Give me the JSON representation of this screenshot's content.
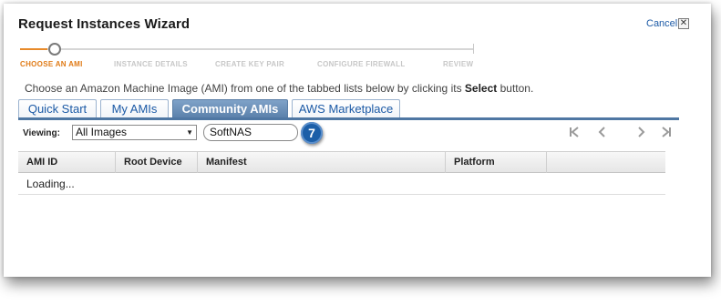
{
  "window": {
    "title": "Request Instances Wizard",
    "cancel_label": "Cancel",
    "close_glyph": "✕"
  },
  "steps": [
    {
      "label": "CHOOSE AN AMI",
      "active": true
    },
    {
      "label": "INSTANCE DETAILS",
      "active": false
    },
    {
      "label": "CREATE KEY PAIR",
      "active": false
    },
    {
      "label": "CONFIGURE FIREWALL",
      "active": false
    },
    {
      "label": "REVIEW",
      "active": false
    }
  ],
  "instructions": {
    "before": "Choose an Amazon Machine Image (AMI) from one of the tabbed lists below by clicking its ",
    "bold": "Select",
    "after": " button."
  },
  "tabs": [
    {
      "label": "Quick Start",
      "selected": false
    },
    {
      "label": "My AMIs",
      "selected": false
    },
    {
      "label": "Community AMIs",
      "selected": true
    },
    {
      "label": "AWS Marketplace",
      "selected": false
    }
  ],
  "filter": {
    "viewing_label": "Viewing:",
    "selected_option": "All Images",
    "search_value": "SoftNAS",
    "callout_number": "7"
  },
  "pager": {
    "first": "|<",
    "prev": "<",
    "next": ">",
    "last": ">|"
  },
  "grid": {
    "columns": [
      "AMI ID",
      "Root Device",
      "Manifest",
      "Platform"
    ],
    "status_text": "Loading..."
  },
  "colors": {
    "accent": "#e07b17",
    "tab_selected": "#5a80aa",
    "link": "#1c5aa6",
    "callout": "#1c5fa8"
  }
}
